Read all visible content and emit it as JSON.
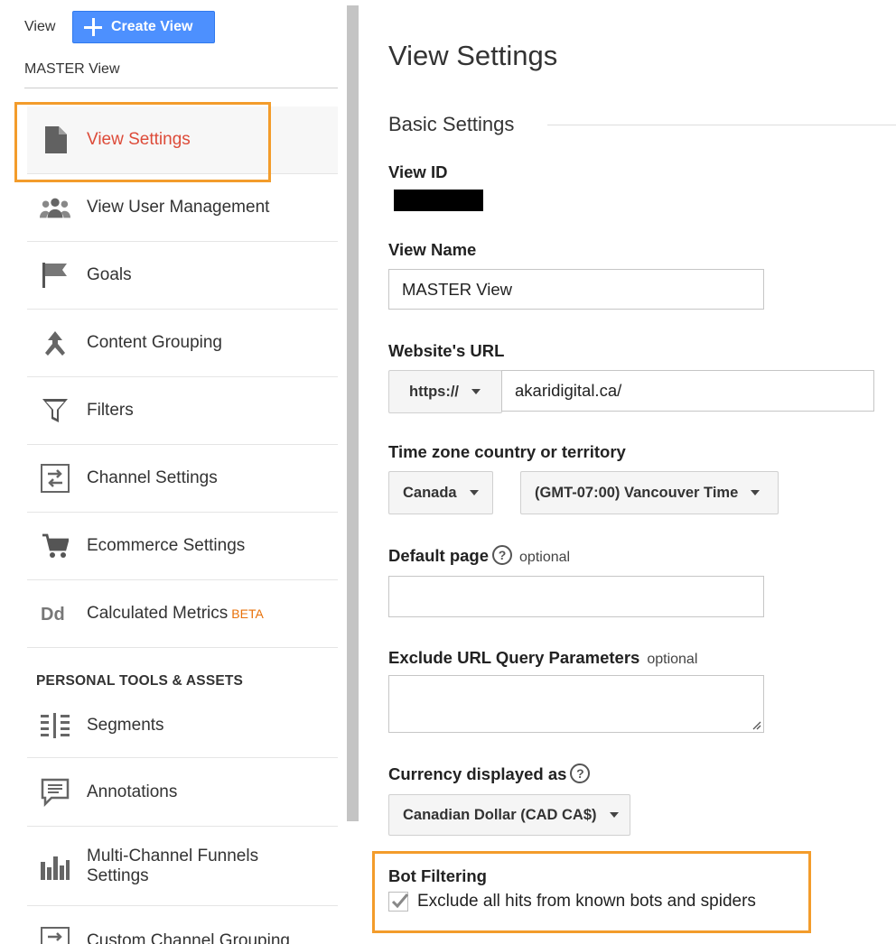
{
  "header": {
    "view_label": "View",
    "create_view_label": "Create View",
    "current_view": "MASTER View"
  },
  "sidebar": {
    "items": [
      {
        "label": "View Settings",
        "icon": "document-icon",
        "active": true
      },
      {
        "label": "View User Management",
        "icon": "users-icon"
      },
      {
        "label": "Goals",
        "icon": "flag-icon"
      },
      {
        "label": "Content Grouping",
        "icon": "content-grouping-icon"
      },
      {
        "label": "Filters",
        "icon": "filter-icon"
      },
      {
        "label": "Channel Settings",
        "icon": "channel-settings-icon"
      },
      {
        "label": "Ecommerce Settings",
        "icon": "cart-icon"
      },
      {
        "label": "Calculated Metrics",
        "badge": "BETA",
        "icon": "calculated-metrics-icon"
      }
    ],
    "section_heading": "PERSONAL TOOLS & ASSETS",
    "personal_items": [
      {
        "label": "Segments",
        "icon": "segments-icon"
      },
      {
        "label": "Annotations",
        "icon": "annotations-icon"
      },
      {
        "label_line1": "Multi-Channel Funnels",
        "label_line2": "Settings",
        "icon": "bar-chart-icon"
      },
      {
        "label": "Custom Channel Grouping",
        "icon": "custom-channel-icon"
      }
    ]
  },
  "main": {
    "title": "View Settings",
    "section_title": "Basic Settings",
    "view_id_label": "View ID",
    "view_name_label": "View Name",
    "view_name_value": "MASTER View",
    "website_url_label": "Website's URL",
    "protocol": "https://",
    "website_url_value": "akaridigital.ca/",
    "timezone_label": "Time zone country or territory",
    "country": "Canada",
    "timezone": "(GMT-07:00) Vancouver Time",
    "default_page_label": "Default page",
    "optional_text": "optional",
    "default_page_value": "",
    "exclude_params_label": "Exclude URL Query Parameters",
    "currency_label": "Currency displayed as",
    "currency": "Canadian Dollar (CAD CA$)",
    "bot_filtering_label": "Bot Filtering",
    "bot_filtering_checkbox": "Exclude all hits from known bots and spiders",
    "bot_filtering_checked": true
  },
  "colors": {
    "accent_blue": "#4d90fe",
    "active_red": "#dd4b39",
    "highlight_orange": "#f39c2b",
    "beta_orange": "#e8710a"
  }
}
